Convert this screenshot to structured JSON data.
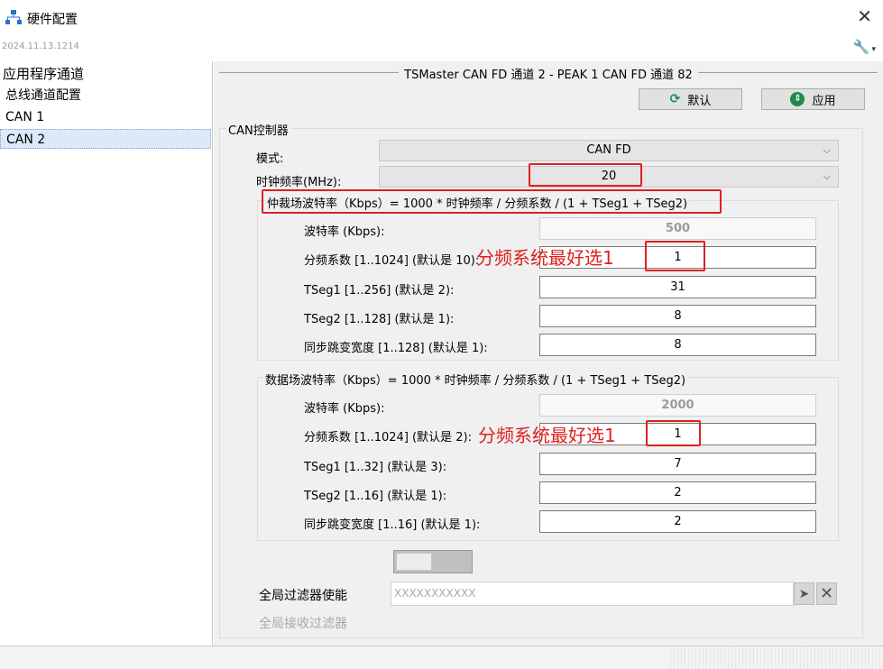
{
  "window": {
    "title": "硬件配置",
    "date": "2024.11.13.1214",
    "close_glyph": "✕",
    "wrench_glyph": "🔧",
    "menu_caret": "▾"
  },
  "sidebar": {
    "items": [
      {
        "label": "应用程序通道"
      },
      {
        "label": "总线通道配置"
      },
      {
        "label": "CAN 1"
      },
      {
        "label": "CAN 2"
      }
    ]
  },
  "main": {
    "header": "TSMaster CAN FD 通道 2 - PEAK 1 CAN FD 通道 82",
    "buttons": {
      "default_label": "默认",
      "apply_label": "应用",
      "default_icon": "refresh-icon",
      "apply_icon": "apply-icon"
    },
    "controller_group": "CAN控制器",
    "mode": {
      "label": "模式:",
      "value": "CAN FD"
    },
    "clock": {
      "label": "时钟频率(MHz):",
      "value": "20"
    },
    "arbitration": {
      "title": "仲裁场波特率（Kbps）= 1000 * 时钟频率 / 分频系数 / (1 + TSeg1 + TSeg2)",
      "rows": [
        {
          "label": "波特率 (Kbps):",
          "value": "500"
        },
        {
          "label": "分频系数 [1..1024] (默认是 10):",
          "value": "1"
        },
        {
          "label": "TSeg1 [1..256] (默认是 2):",
          "value": "31"
        },
        {
          "label": "TSeg2 [1..128] (默认是 1):",
          "value": "8"
        },
        {
          "label": "同步跳变宽度 [1..128] (默认是 1):",
          "value": "8"
        }
      ]
    },
    "data": {
      "title": "数据场波特率（Kbps）= 1000 * 时钟频率 / 分频系数 / (1 + TSeg1 + TSeg2)",
      "rows": [
        {
          "label": "波特率 (Kbps):",
          "value": "2000"
        },
        {
          "label": "分频系数 [1..1024] (默认是 2):",
          "value": "1"
        },
        {
          "label": "TSeg1 [1..32] (默认是 3):",
          "value": "7"
        },
        {
          "label": "TSeg2 [1..16] (默认是 1):",
          "value": "2"
        },
        {
          "label": "同步跳变宽度 [1..16] (默认是 1):",
          "value": "2"
        }
      ]
    },
    "annotations": {
      "note_arbitration": "分频系统最好选1",
      "note_data": "分频系统最好选1"
    },
    "filter": {
      "enable_label": "全局过滤器使能",
      "accept_label": "全局接收过滤器",
      "value": "XXXXXXXXXXX",
      "toggle_state": "off"
    },
    "colors": {
      "annotation_red": "#e02020",
      "selected_bg": "#dbe9f9",
      "panel_bg": "#f0f0f0"
    }
  }
}
